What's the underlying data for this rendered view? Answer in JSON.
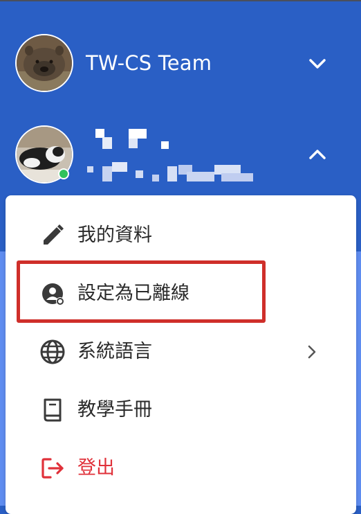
{
  "header": {
    "team": {
      "name": "TW-CS Team",
      "avatar_icon": "wombat-photo",
      "expand_icon": "chevron-down-icon"
    },
    "user": {
      "avatar_icon": "cat-photo",
      "status": "online",
      "status_color": "#2fc25b",
      "collapse_icon": "chevron-up-icon"
    }
  },
  "menu": {
    "items": [
      {
        "label": "我的資料",
        "icon": "pencil-icon"
      },
      {
        "label": "設定為已離線",
        "icon": "offline-user-icon"
      },
      {
        "label": "系統語言",
        "icon": "globe-icon",
        "submenu_icon": "chevron-right-icon"
      },
      {
        "label": "教學手冊",
        "icon": "book-icon"
      },
      {
        "label": "登出",
        "icon": "logout-icon",
        "color": "#e0313a"
      }
    ]
  },
  "colors": {
    "header_bg": "#2a5fc5",
    "highlight": "#cf2f2a",
    "danger": "#e0313a"
  }
}
